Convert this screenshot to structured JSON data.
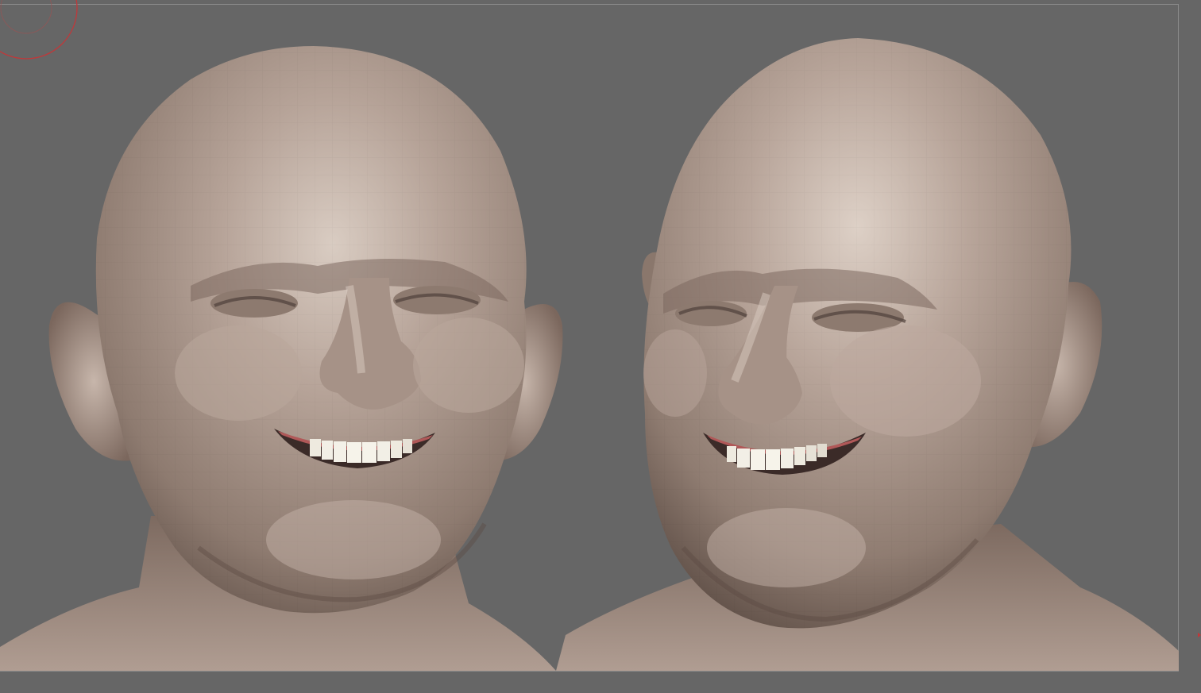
{
  "app": {
    "viewport_background": "#666666",
    "frame_color": "#8a8a8a",
    "cursor_color": "#c0383a"
  },
  "scene": {
    "views": [
      {
        "name": "front-view",
        "icon": "head-sculpt-icon"
      },
      {
        "name": "three-quarter-view",
        "icon": "head-sculpt-icon"
      }
    ],
    "material": {
      "skin": "#a8958a",
      "skin_light": "#d3c5bb",
      "skin_shadow": "#6f5d53",
      "teeth": "#f2efe6",
      "gum": "#b05858"
    }
  }
}
